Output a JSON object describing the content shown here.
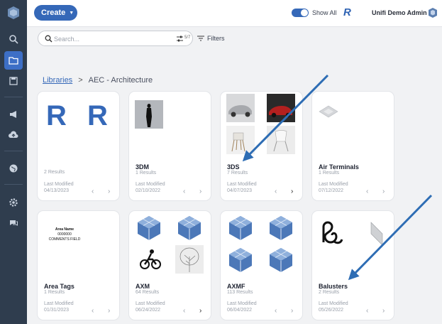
{
  "topbar": {
    "create_label": "Create",
    "show_all_label": "Show All",
    "brand_letter": "R",
    "user_name": "Unifi Demo Admin"
  },
  "search": {
    "placeholder": "Search...",
    "count": "5/7",
    "filters_label": "Filters"
  },
  "breadcrumb": {
    "root": "Libraries",
    "separator": ">",
    "current": "AEC - Architecture"
  },
  "cards": [
    {
      "name": "",
      "results": "2 Results",
      "last_modified_label": "Last Modified",
      "date": "04/13/2023"
    },
    {
      "name": "3DM",
      "results": "1 Results",
      "last_modified_label": "Last Modified",
      "date": "02/10/2022"
    },
    {
      "name": "3DS",
      "results": "7 Results",
      "last_modified_label": "Last Modified",
      "date": "04/07/2023"
    },
    {
      "name": "Air Terminals",
      "results": "1 Results",
      "last_modified_label": "Last Modified",
      "date": "07/12/2022"
    },
    {
      "name": "Area Tags",
      "results": "1 Results",
      "last_modified_label": "Last Modified",
      "date": "01/31/2023"
    },
    {
      "name": "AXM",
      "results": "64 Results",
      "last_modified_label": "Last Modified",
      "date": "06/24/2022"
    },
    {
      "name": "AXMF",
      "results": "113 Results",
      "last_modified_label": "Last Modified",
      "date": "06/04/2022"
    },
    {
      "name": "Balusters",
      "results": "2 Results",
      "last_modified_label": "Last Modified",
      "date": "05/26/2022"
    }
  ],
  "area_tag_preview": {
    "line1": "Area Name",
    "line2": "0000000",
    "line3": "COMMENTS FIELD"
  },
  "colors": {
    "accent": "#3568b8",
    "rail": "#2f3d4e",
    "annotation_arrow": "#2e6db4"
  }
}
